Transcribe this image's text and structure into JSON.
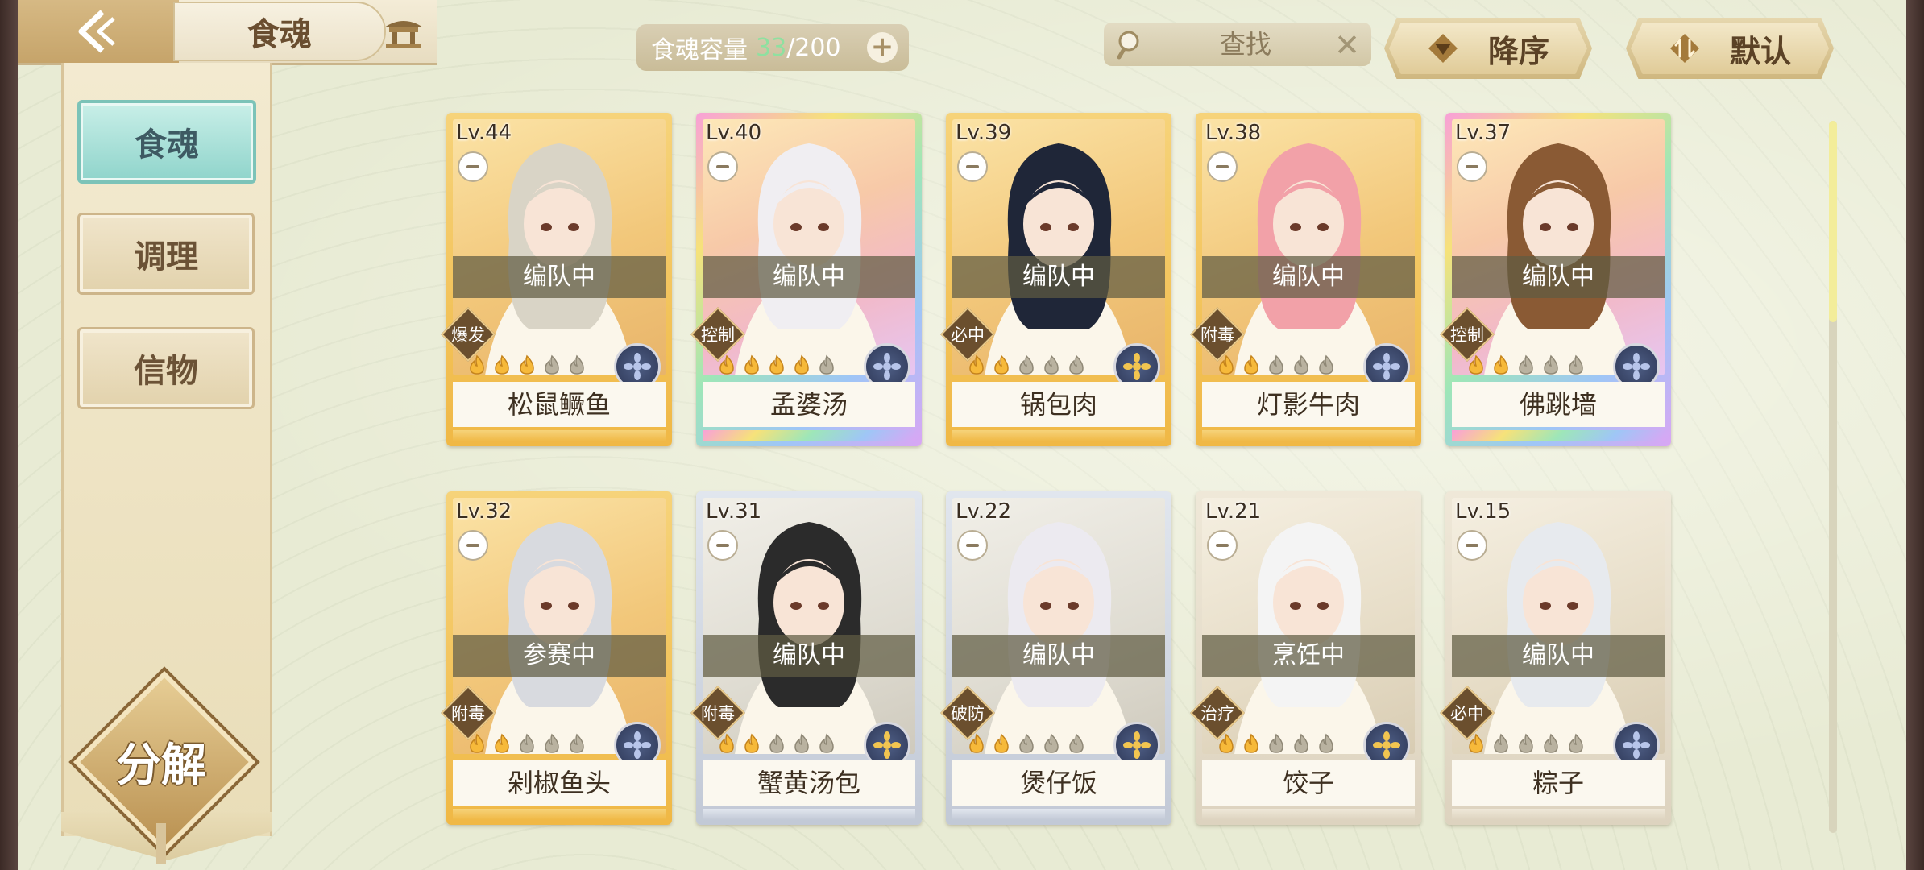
{
  "header": {
    "title": "食魂",
    "capacity": {
      "label": "食魂容量",
      "current": "33",
      "max": "/200"
    },
    "search": {
      "placeholder": "查找"
    },
    "sort_desc_label": "降序",
    "sort_default_label": "默认"
  },
  "nav": [
    {
      "label": "食魂",
      "active": true
    },
    {
      "label": "调理",
      "active": false
    },
    {
      "label": "信物",
      "active": false
    }
  ],
  "decompose_label": "分解",
  "cards": [
    {
      "level": "Lv.44",
      "status": "编队中",
      "role": "爆发",
      "name": "松鼠鳜鱼",
      "stars_lit": 3,
      "element": "blue",
      "rarity": "gold"
    },
    {
      "level": "Lv.40",
      "status": "编队中",
      "role": "控制",
      "name": "孟婆汤",
      "stars_lit": 4,
      "element": "blue",
      "rarity": "rainbow"
    },
    {
      "level": "Lv.39",
      "status": "编队中",
      "role": "必中",
      "name": "锅包肉",
      "stars_lit": 2,
      "element": "gold",
      "rarity": "gold"
    },
    {
      "level": "Lv.38",
      "status": "编队中",
      "role": "附毒",
      "name": "灯影牛肉",
      "stars_lit": 2,
      "element": "blue",
      "rarity": "gold"
    },
    {
      "level": "Lv.37",
      "status": "编队中",
      "role": "控制",
      "name": "佛跳墙",
      "stars_lit": 2,
      "element": "blue",
      "rarity": "rainbow"
    },
    {
      "level": "Lv.32",
      "status": "参赛中",
      "role": "附毒",
      "name": "剁椒鱼头",
      "stars_lit": 2,
      "element": "blue",
      "rarity": "gold"
    },
    {
      "level": "Lv.31",
      "status": "编队中",
      "role": "附毒",
      "name": "蟹黄汤包",
      "stars_lit": 2,
      "element": "gold",
      "rarity": "silver"
    },
    {
      "level": "Lv.22",
      "status": "编队中",
      "role": "破防",
      "name": "煲仔饭",
      "stars_lit": 2,
      "element": "gold",
      "rarity": "silver"
    },
    {
      "level": "Lv.21",
      "status": "烹饪中",
      "role": "治疗",
      "name": "饺子",
      "stars_lit": 2,
      "element": "gold",
      "rarity": "plain"
    },
    {
      "level": "Lv.15",
      "status": "编队中",
      "role": "必中",
      "name": "粽子",
      "stars_lit": 1,
      "element": "blue",
      "rarity": "plain"
    }
  ],
  "colors": {
    "accent_teal": "#8fd4cb",
    "capacity_current": "#8fe0a0",
    "frame_gold": "#f2c25a",
    "status_overlay": "#605c42"
  }
}
